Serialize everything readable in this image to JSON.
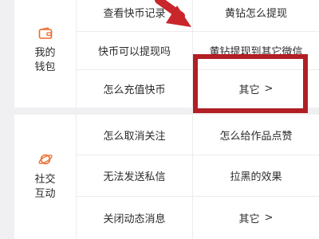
{
  "wallet": {
    "label": "我的钱包",
    "icon": "wallet-icon",
    "accent": "#ee6a2a",
    "rows": [
      {
        "left": "查看快币记录",
        "right": "黄钻怎么提现"
      },
      {
        "left": "快币可以提现吗",
        "right": "黄钻提现到其它微信"
      },
      {
        "left": "怎么充值快币",
        "right": "其它"
      }
    ]
  },
  "social": {
    "label": "社交互动",
    "icon": "planet-icon",
    "accent": "#ee6a2a",
    "rows": [
      {
        "left": "怎么取消关注",
        "right": "怎么给作品点赞"
      },
      {
        "left": "无法发送私信",
        "right": "拉黑的效果"
      },
      {
        "left": "关闭动态消息",
        "right": "其它"
      }
    ]
  },
  "annotation": {
    "box_color": "#b11f24",
    "arrow_color": "#c8262b"
  }
}
